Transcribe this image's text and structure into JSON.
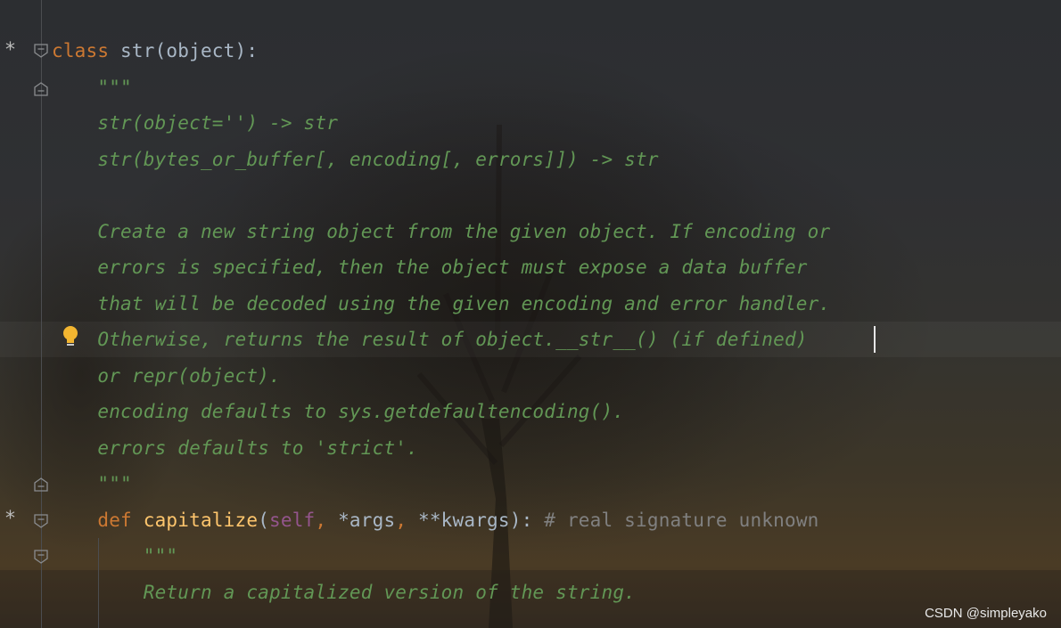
{
  "editor": {
    "lines": [
      {
        "indent": "",
        "tokens": [
          [
            "kw",
            "class"
          ],
          [
            "plain",
            " str(object):"
          ]
        ]
      },
      {
        "indent": "    ",
        "tokens": [
          [
            "doc",
            "\"\"\""
          ]
        ]
      },
      {
        "indent": "    ",
        "tokens": [
          [
            "doc",
            "str(object='') -> str"
          ]
        ]
      },
      {
        "indent": "    ",
        "tokens": [
          [
            "doc",
            "str(bytes_or_buffer[, encoding[, errors]]) -> str"
          ]
        ]
      },
      {
        "indent": "",
        "tokens": []
      },
      {
        "indent": "    ",
        "tokens": [
          [
            "doc",
            "Create a new string object from the given object. If encoding or"
          ]
        ]
      },
      {
        "indent": "    ",
        "tokens": [
          [
            "doc",
            "errors is specified, then the object must expose a data buffer"
          ]
        ]
      },
      {
        "indent": "    ",
        "tokens": [
          [
            "doc",
            "that will be decoded using the given encoding and error handler."
          ]
        ]
      },
      {
        "indent": "    ",
        "tokens": [
          [
            "doc",
            "Otherwise, returns the result of object.__str__() (if defined)"
          ]
        ]
      },
      {
        "indent": "    ",
        "tokens": [
          [
            "doc",
            "or repr(object)."
          ]
        ]
      },
      {
        "indent": "    ",
        "tokens": [
          [
            "doc",
            "encoding defaults to sys.getdefaultencoding()."
          ]
        ]
      },
      {
        "indent": "    ",
        "tokens": [
          [
            "doc",
            "errors defaults to 'strict'."
          ]
        ]
      },
      {
        "indent": "    ",
        "tokens": [
          [
            "doc",
            "\"\"\""
          ]
        ]
      },
      {
        "indent": "    ",
        "tokens": [
          [
            "kw",
            "def "
          ],
          [
            "fn",
            "capitalize"
          ],
          [
            "plain",
            "("
          ],
          [
            "self",
            "self"
          ],
          [
            "kw",
            ", "
          ],
          [
            "plain",
            "*args"
          ],
          [
            "kw",
            ", "
          ],
          [
            "plain",
            "**kwargs): "
          ],
          [
            "cmt",
            "# real signature unknown"
          ]
        ]
      },
      {
        "indent": "        ",
        "tokens": [
          [
            "doc",
            "\"\"\""
          ]
        ]
      },
      {
        "indent": "        ",
        "tokens": [
          [
            "doc",
            "Return a capitalized version of the string."
          ]
        ]
      }
    ],
    "gutter_markers": {
      "star": "*"
    },
    "colors": {
      "docstring": "#629755",
      "keyword": "#cc7832",
      "identifier": "#a9b7c6",
      "function": "#ffc66d",
      "self": "#94558d",
      "comment": "#808080"
    },
    "icons": [
      "fold-icon",
      "lightbulb-icon"
    ]
  },
  "watermark": "CSDN @simpleyako"
}
